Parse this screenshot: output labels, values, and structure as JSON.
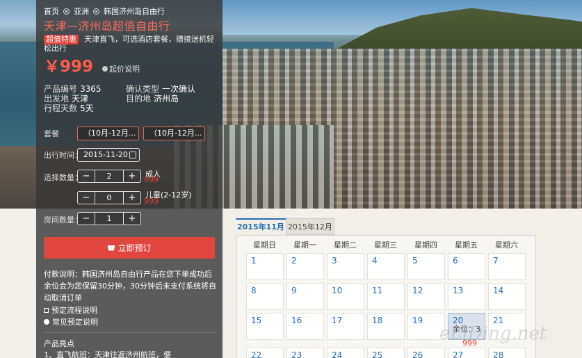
{
  "breadcrumb": [
    "首页",
    "亚洲",
    "韩国济州岛自由行"
  ],
  "product": {
    "title": "天津—济州岛超值自由行",
    "promo_badge": "超值特惠",
    "promo_text": "天津直飞，可选酒店套餐，赠接送机轻松出行",
    "price": "￥999",
    "price_note": "起价说明"
  },
  "info": {
    "code_label": "产品编号",
    "code_value": "3365",
    "confirm_label": "确认类型",
    "confirm_value": "一次确认",
    "departure_label": "出发地",
    "departure_value": "天津",
    "destination_label": "目的地",
    "destination_value": "济州岛",
    "days_label": "行程天数",
    "days_value": "5天"
  },
  "form": {
    "package_label": "套餐",
    "package_options": [
      "（10月-12月...",
      "（10月-12月..."
    ],
    "date_label": "出行时间：",
    "date_value": "2015-11-20",
    "adult_label": "选择数量：",
    "adult_value": "2",
    "adult_name": "成人",
    "adult_price": "999",
    "child_value": "0",
    "child_name": "儿童(2-12岁)",
    "child_price": "999",
    "room_label": "房间数量：",
    "room_value": "1",
    "minus": "−",
    "plus": "+"
  },
  "book_button": "立即预订",
  "payment_note": "付款说明：韩国济州岛自由行产品在您下单成功后余位会为您保留30分钟，30分钟后未支付系统将自动取消订单",
  "links": [
    "预定流程说明",
    "常见预定说明"
  ],
  "highlights": {
    "title": "产品亮点",
    "text": "1、直飞航班：天津往返济州航班，便"
  },
  "calendar": {
    "tabs": [
      "2015年11月",
      "2015年12月"
    ],
    "weekdays": [
      "星期日",
      "星期一",
      "星期二",
      "星期三",
      "星期四",
      "星期五",
      "星期六"
    ],
    "weeks": [
      [
        "1",
        "2",
        "3",
        "4",
        "5",
        "6",
        "7"
      ],
      [
        "8",
        "9",
        "10",
        "11",
        "12",
        "13",
        "14"
      ],
      [
        "15",
        "16",
        "17",
        "18",
        "19",
        "20",
        "21"
      ],
      [
        "22",
        "23",
        "24",
        "25",
        "26",
        "27",
        "28"
      ]
    ],
    "selected_day": "20",
    "remaining_label": "余位：",
    "remaining_value": "3",
    "day_price": "999"
  },
  "watermark": "eLiDing.net",
  "colors": {
    "accent": "#e2473f",
    "link_blue": "#2a6fb0",
    "panel": "#3a3a3a"
  }
}
